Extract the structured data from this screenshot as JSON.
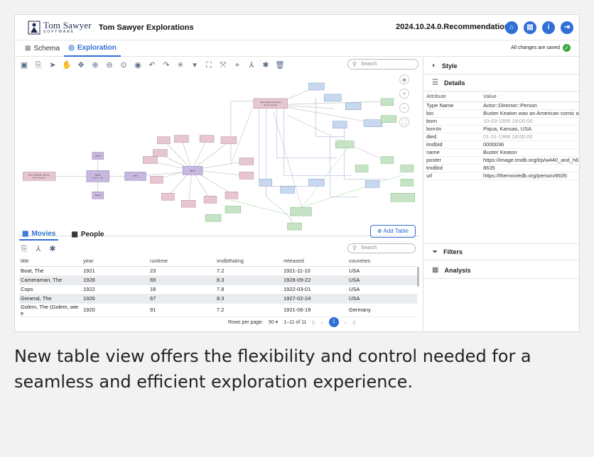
{
  "header": {
    "logo_line1": "Tom Sawyer",
    "logo_line2": "SOFTWARE",
    "app_title": "Tom Sawyer Explorations",
    "version": "2024.10.24.0.Recommendations",
    "icons": [
      "home-icon",
      "document-icon",
      "info-icon",
      "logout-icon"
    ]
  },
  "tabs": [
    {
      "label": "Schema",
      "icon": "schema-icon"
    },
    {
      "label": "Exploration",
      "icon": "compass-icon"
    }
  ],
  "status": {
    "saved_text": "All changes are saved"
  },
  "graph_search": {
    "placeholder": "Search"
  },
  "graph": {
    "nodes": [
      {
        "id": "actor1",
        "type": "Actor::Director::Person",
        "name": "Buster Keaton",
        "color": "#e6c6cf"
      },
      {
        "id": "movie1",
        "type": "Movie",
        "name": "Golem, The",
        "color": "#c8b8e0"
      },
      {
        "id": "actor2",
        "type": "Actor::Director::Person",
        "name": "Paul Wegener",
        "color": "#e6c6cf"
      },
      {
        "id": "user1",
        "type": "User",
        "name": "user",
        "color": "#e6c6cf"
      },
      {
        "id": "movie2",
        "type": "Movie",
        "name": "Cops",
        "color": "#c8d8ee"
      },
      {
        "id": "genre1",
        "type": "Genre",
        "name": "Comedy",
        "color": "#c6e3c6"
      },
      {
        "id": "actor3",
        "type": "Actor::Director::Person",
        "name": "Eddie Cline",
        "color": "#c6e3c6"
      }
    ]
  },
  "table_tabs": [
    {
      "label": "Movies",
      "icon": "table-icon"
    },
    {
      "label": "People",
      "icon": "table-icon"
    }
  ],
  "add_table_label": "Add Table",
  "table_search": {
    "placeholder": "Search"
  },
  "table": {
    "columns": [
      "title",
      "year",
      "runtime",
      "imdbRating",
      "released",
      "countries"
    ],
    "rows": [
      [
        "Boat, The",
        "1921",
        "23",
        "7.2",
        "1921-11-10",
        "USA"
      ],
      [
        "Cameraman, The",
        "1928",
        "69",
        "8.3",
        "1928-09-22",
        "USA"
      ],
      [
        "Cops",
        "1922",
        "18",
        "7.8",
        "1922-03-01",
        "USA"
      ],
      [
        "General, The",
        "1926",
        "67",
        "8.3",
        "1927-02-24",
        "USA"
      ],
      [
        "Golem, The (Golem, wie e",
        "1920",
        "91",
        "7.2",
        "1921-06-19",
        "Germany"
      ]
    ]
  },
  "pager": {
    "rows_per_page_label": "Rows per page:",
    "rows_per_page": "50",
    "range": "1–11 of 11",
    "page": "1"
  },
  "right_panel": {
    "style_label": "Style",
    "details_label": "Details",
    "details_header": {
      "attr": "Attribute",
      "val": "Value"
    },
    "details": [
      {
        "k": "Type Name",
        "v": "Actor::Director::Person",
        "muted": false
      },
      {
        "k": "bio",
        "v": "Buster Keaton was an American comic a",
        "muted": false
      },
      {
        "k": "born",
        "v": "10-03-1895 18:00:00",
        "muted": true
      },
      {
        "k": "bornIn",
        "v": "Piqua, Kansas, USA",
        "muted": false
      },
      {
        "k": "died",
        "v": "01-31-1966 18:00:00",
        "muted": true
      },
      {
        "k": "imdbId",
        "v": "0000036",
        "muted": false
      },
      {
        "k": "name",
        "v": "Buster Keaton",
        "muted": false
      },
      {
        "k": "poster",
        "v": "https://image.tmdb.org/t/p/w440_and_h6",
        "muted": false
      },
      {
        "k": "tmdbId",
        "v": "8635",
        "muted": false
      },
      {
        "k": "url",
        "v": "https://themoviedb.org/person/8635",
        "muted": false
      }
    ],
    "filters_label": "Filters",
    "analysis_label": "Analysis"
  },
  "caption": "New table view offers the flexibility and control needed for a seamless and efficient exploration experience."
}
